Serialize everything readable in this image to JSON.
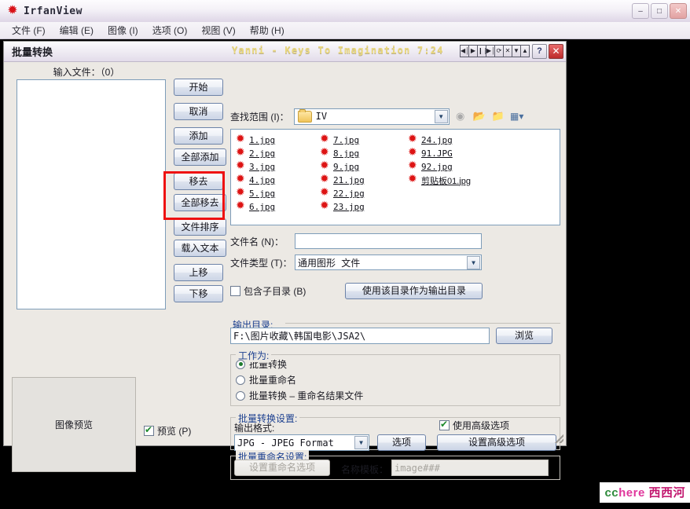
{
  "app": {
    "title": "IrfanView",
    "icon": "star-icon",
    "window_buttons": {
      "minimize": "–",
      "maximize": "□",
      "close": "✕"
    },
    "menu": [
      "文件 (F)",
      "编辑 (E)",
      "图像 (I)",
      "选项 (O)",
      "视图 (V)",
      "帮助 (H)"
    ]
  },
  "dialog": {
    "title": "批量转换",
    "now_playing": "Yanni - Keys To Imagination   7:24",
    "media_controls": [
      "◀│",
      "▶",
      "❙❙",
      "▶│",
      "⟳",
      "✕",
      "▼",
      "▲"
    ],
    "help_button": "?",
    "close_button": "✕"
  },
  "left": {
    "input_files_label": "输入文件：（0）",
    "buttons": [
      {
        "label": "开始",
        "name": "start-button"
      },
      {
        "label": "取消",
        "name": "cancel-button"
      },
      {
        "label": "添加",
        "name": "add-button"
      },
      {
        "label": "全部添加",
        "name": "add-all-button"
      },
      {
        "label": "移去",
        "name": "remove-button"
      },
      {
        "label": "全部移去",
        "name": "remove-all-button"
      },
      {
        "label": "文件排序",
        "name": "sort-files-button"
      },
      {
        "label": "载入文本",
        "name": "load-text-button"
      },
      {
        "label": "上移",
        "name": "move-up-button"
      },
      {
        "label": "下移",
        "name": "move-down-button"
      }
    ],
    "preview_panel_label": "图像预览",
    "preview_checkbox": {
      "label": "预览 (P)",
      "checked": true
    },
    "highlight_color": "#ee1111"
  },
  "browser": {
    "lookin_label": "查找范围 (I)：",
    "lookin_value": "IV",
    "nav_icons": [
      "back-icon",
      "up-folder-icon",
      "new-folder-icon",
      "views-icon"
    ],
    "file_columns": [
      [
        "1.jpg",
        "2.jpg",
        "3.jpg",
        "4.jpg",
        "5.jpg",
        "6.jpg"
      ],
      [
        "7.jpg",
        "8.jpg",
        "9.jpg",
        "21.jpg",
        "22.jpg",
        "23.jpg"
      ],
      [
        "24.jpg",
        "91.JPG",
        "92.jpg",
        "剪贴板01.jpg"
      ]
    ],
    "filename_label": "文件名 (N)：",
    "filename_value": "",
    "filetype_label": "文件类型 (T)：",
    "filetype_value": "通用图形  文件",
    "include_subdirs": {
      "label": "包含子目录 (B)",
      "checked": false
    },
    "use_dir_button": "使用该目录作为输出目录"
  },
  "output": {
    "group_title": "输出目录:",
    "path": "F:\\图片收藏\\韩国电影\\JSA2\\",
    "browse_button": "浏览"
  },
  "work": {
    "group_title": "工作为:",
    "options": [
      {
        "label": "批量转换",
        "selected": true
      },
      {
        "label": "批量重命名",
        "selected": false
      },
      {
        "label": "批量转换 – 重命名结果文件",
        "selected": false
      }
    ]
  },
  "convert": {
    "group_title": "批量转换设置:",
    "format_label": "输出格式:",
    "format_value": "JPG - JPEG Format",
    "options_button": "选项",
    "advanced_checkbox": {
      "label": "使用高级选项",
      "checked": true
    },
    "advanced_button": "设置高级选项"
  },
  "rename": {
    "group_title": "批量重命名设置:",
    "options_button": "设置重命名选项",
    "template_label": "名称模板：",
    "template_placeholder": "image###"
  },
  "watermark": {
    "cc": "cc",
    "here": "here",
    "cn": "西西河"
  }
}
